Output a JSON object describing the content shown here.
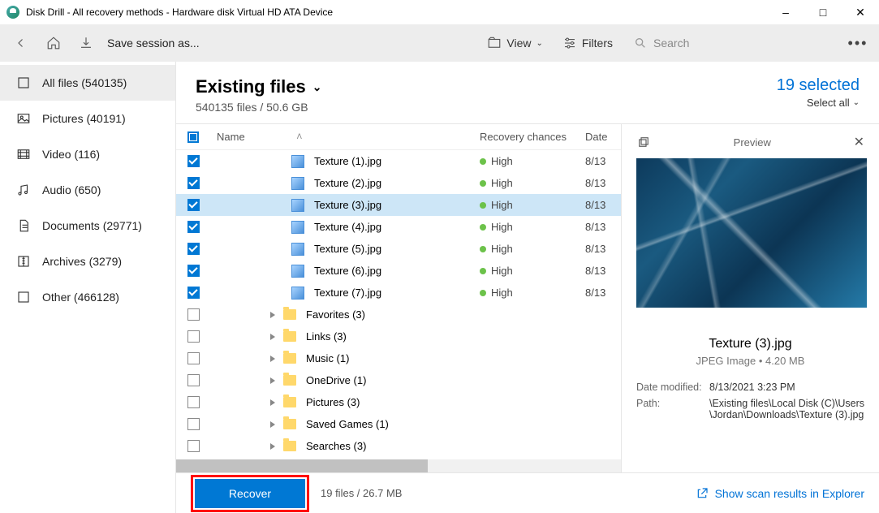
{
  "window": {
    "title": "Disk Drill - All recovery methods - Hardware disk Virtual HD ATA Device"
  },
  "toolbar": {
    "save_session": "Save session as...",
    "view": "View",
    "filters": "Filters",
    "search_placeholder": "Search"
  },
  "sidebar": {
    "items": [
      {
        "label": "All files (540135)"
      },
      {
        "label": "Pictures (40191)"
      },
      {
        "label": "Video (116)"
      },
      {
        "label": "Audio (650)"
      },
      {
        "label": "Documents (29771)"
      },
      {
        "label": "Archives (3279)"
      },
      {
        "label": "Other (466128)"
      }
    ]
  },
  "main": {
    "title": "Existing files",
    "subtitle": "540135 files / 50.6 GB",
    "selected_text": "19 selected",
    "select_all": "Select all"
  },
  "columns": {
    "name": "Name",
    "recovery": "Recovery chances",
    "date": "Date"
  },
  "rows": [
    {
      "type": "file",
      "checked": true,
      "name": "Texture (1).jpg",
      "rec": "High",
      "date": "8/13"
    },
    {
      "type": "file",
      "checked": true,
      "name": "Texture (2).jpg",
      "rec": "High",
      "date": "8/13"
    },
    {
      "type": "file",
      "checked": true,
      "sel": true,
      "name": "Texture (3).jpg",
      "rec": "High",
      "date": "8/13"
    },
    {
      "type": "file",
      "checked": true,
      "name": "Texture (4).jpg",
      "rec": "High",
      "date": "8/13"
    },
    {
      "type": "file",
      "checked": true,
      "name": "Texture (5).jpg",
      "rec": "High",
      "date": "8/13"
    },
    {
      "type": "file",
      "checked": true,
      "name": "Texture (6).jpg",
      "rec": "High",
      "date": "8/13"
    },
    {
      "type": "file",
      "checked": true,
      "name": "Texture (7).jpg",
      "rec": "High",
      "date": "8/13"
    },
    {
      "type": "folder",
      "checked": false,
      "name": "Favorites (3)"
    },
    {
      "type": "folder",
      "checked": false,
      "name": "Links (3)"
    },
    {
      "type": "folder",
      "checked": false,
      "name": "Music (1)"
    },
    {
      "type": "folder",
      "checked": false,
      "name": "OneDrive (1)"
    },
    {
      "type": "folder",
      "checked": false,
      "name": "Pictures (3)"
    },
    {
      "type": "folder",
      "checked": false,
      "name": "Saved Games (1)"
    },
    {
      "type": "folder",
      "checked": false,
      "name": "Searches (3)"
    }
  ],
  "preview": {
    "title": "Preview",
    "filename": "Texture (3).jpg",
    "meta": "JPEG Image • 4.20 MB",
    "date_modified_label": "Date modified:",
    "date_modified": "8/13/2021 3:23 PM",
    "path_label": "Path:",
    "path": "\\Existing files\\Local Disk (C)\\Users\\Jordan\\Downloads\\Texture (3).jpg"
  },
  "footer": {
    "recover": "Recover",
    "info": "19 files / 26.7 MB",
    "explorer": "Show scan results in Explorer"
  }
}
